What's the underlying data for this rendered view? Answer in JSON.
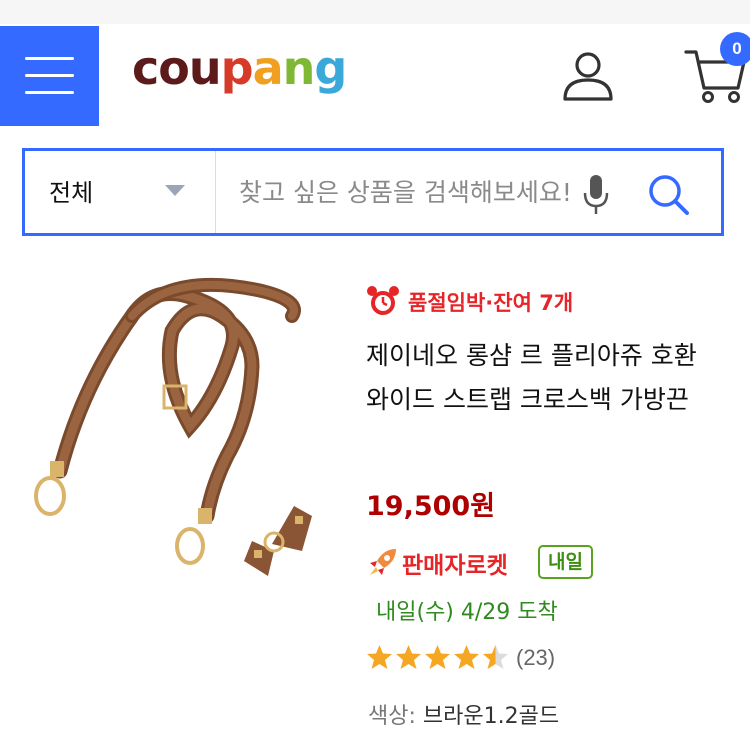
{
  "header": {
    "logo_letters": [
      {
        "ch": "c",
        "color": "#5c1a1a"
      },
      {
        "ch": "o",
        "color": "#5c1a1a"
      },
      {
        "ch": "u",
        "color": "#5c1a1a"
      },
      {
        "ch": "p",
        "color": "#d63b2a"
      },
      {
        "ch": "a",
        "color": "#f0a020"
      },
      {
        "ch": "n",
        "color": "#7fb835"
      },
      {
        "ch": "g",
        "color": "#3aa8d8"
      }
    ],
    "cart_count": "0",
    "accent_color": "#346aff"
  },
  "search": {
    "category": "전체",
    "placeholder": "찾고 싶은 상품을 검색해보세요!"
  },
  "product": {
    "urgency": "품절임박·잔여 7개",
    "title": "제이네오 롱샴 르 플리아쥬 호환 와이드 스트랩 크로스백 가방끈",
    "price": "19,500원",
    "delivery_label": "판매자로켓",
    "delivery_badge": "내일",
    "arrival": "내일(수) 4/29  도착",
    "rating_value": 4.5,
    "rating_max": 5,
    "review_count": "(23)",
    "color_key": "색상:",
    "color_value": "브라운1.2골드"
  },
  "icons": [
    "menu-icon",
    "user-icon",
    "cart-icon",
    "mic-icon",
    "search-icon",
    "alarm-clock-icon",
    "rocket-icon",
    "star-icon"
  ]
}
